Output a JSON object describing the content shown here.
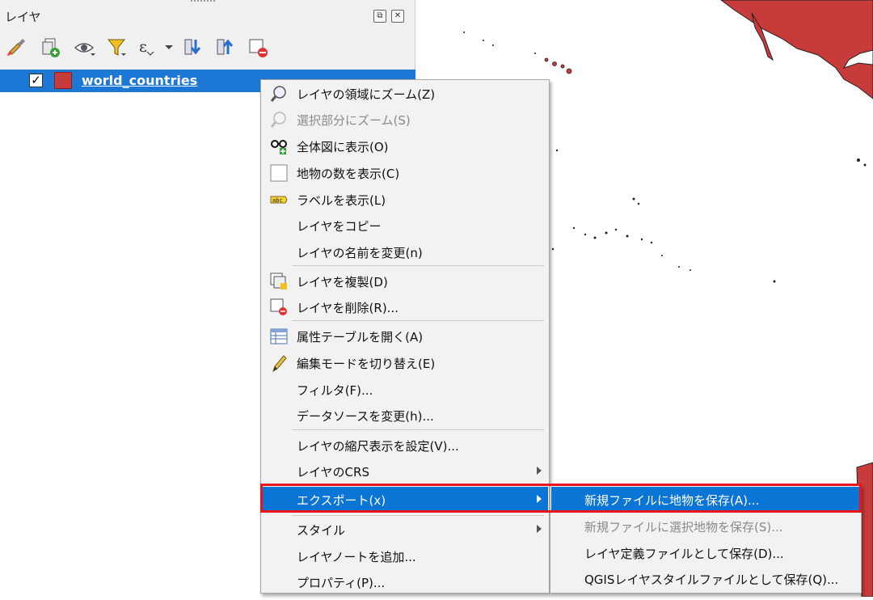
{
  "panel": {
    "title": "レイヤ",
    "float_button": "⧉",
    "close_button": "✕",
    "toolbar": [
      {
        "name": "style-manager-icon"
      },
      {
        "name": "add-group-icon"
      },
      {
        "name": "visibility-eye-icon"
      },
      {
        "name": "filter-legend-icon"
      },
      {
        "name": "expression-filter-icon"
      },
      {
        "name": "expand-all-icon"
      },
      {
        "name": "collapse-all-icon"
      },
      {
        "name": "remove-layer-icon"
      }
    ]
  },
  "layer": {
    "name": "world_countries",
    "checked": "✓",
    "color": "#c73b3b"
  },
  "context_menu": {
    "items": [
      {
        "label": "レイヤの領域にズーム(Z)",
        "icon": "zoom-to-layer-icon",
        "disabled": false
      },
      {
        "label": "選択部分にズーム(S)",
        "icon": "zoom-to-selection-icon",
        "disabled": true
      },
      {
        "label": "全体図に表示(O)",
        "icon": "overview-glasses-icon",
        "disabled": false
      },
      {
        "label": "地物の数を表示(C)",
        "icon": "checkbox-icon",
        "disabled": false
      },
      {
        "label": "ラベルを表示(L)",
        "icon": "label-abc-icon",
        "disabled": false
      },
      {
        "label": "レイヤをコピー",
        "icon": "",
        "disabled": false
      },
      {
        "label": "レイヤの名前を変更(n)",
        "icon": "",
        "disabled": false
      },
      {
        "label": "レイヤを複製(D)",
        "icon": "duplicate-layer-icon",
        "disabled": false
      },
      {
        "label": "レイヤを削除(R)...",
        "icon": "remove-layer-icon",
        "disabled": false
      },
      {
        "label": "属性テーブルを開く(A)",
        "icon": "attribute-table-icon",
        "disabled": false
      },
      {
        "label": "編集モードを切り替え(E)",
        "icon": "pencil-icon",
        "disabled": false
      },
      {
        "label": "フィルタ(F)...",
        "icon": "",
        "disabled": false
      },
      {
        "label": "データソースを変更(h)...",
        "icon": "",
        "disabled": false
      },
      {
        "label": "レイヤの縮尺表示を設定(V)...",
        "icon": "",
        "disabled": false
      },
      {
        "label": "レイヤのCRS",
        "icon": "",
        "disabled": false,
        "submenu": true
      },
      {
        "label": "エクスポート(x)",
        "icon": "",
        "disabled": false,
        "submenu": true,
        "selected": true
      },
      {
        "label": "スタイル",
        "icon": "",
        "disabled": false,
        "submenu": true
      },
      {
        "label": "レイヤノートを追加...",
        "icon": "",
        "disabled": false
      },
      {
        "label": "プロパティ(P)...",
        "icon": "",
        "disabled": false
      }
    ]
  },
  "export_submenu": {
    "items": [
      {
        "label": "新規ファイルに地物を保存(A)...",
        "disabled": false,
        "selected": true
      },
      {
        "label": "新規ファイルに選択地物を保存(S)...",
        "disabled": true
      },
      {
        "label": "レイヤ定義ファイルとして保存(D)...",
        "disabled": false
      },
      {
        "label": "QGISレイヤスタイルファイルとして保存(Q)...",
        "disabled": false
      }
    ]
  },
  "colors": {
    "selection": "#0a75d4",
    "highlight_border": "#e8141b",
    "country_fill": "#c73b3b"
  }
}
